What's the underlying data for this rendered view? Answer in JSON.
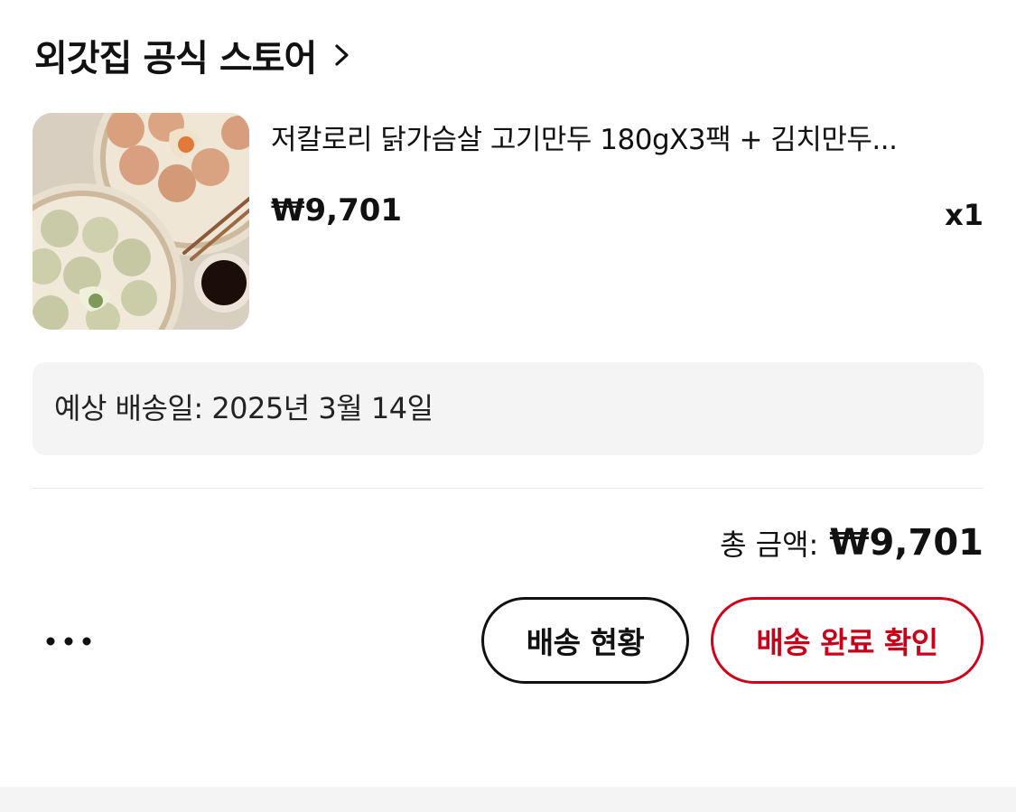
{
  "store": {
    "name": "외갓집 공식 스토어",
    "chevron_icon": "chevron-right-icon"
  },
  "product": {
    "image_icon": "dumpling-product-photo",
    "name": "저칼로리 닭가슴살 고기만두 180gX3팩 + 김치만두...",
    "price": "₩9,701",
    "quantity": "x1"
  },
  "delivery": {
    "estimate_text": "예상 배송일: 2025년 3월 14일"
  },
  "total": {
    "label": "총 금액:",
    "value": "₩9,701"
  },
  "actions": {
    "more_icon": "more-horizontal-icon",
    "track_label": "배송 현황",
    "confirm_label": "배송 완료 확인"
  },
  "colors": {
    "accent_red": "#c8001a",
    "text_primary": "#111111",
    "box_background": "#f4f4f4"
  }
}
